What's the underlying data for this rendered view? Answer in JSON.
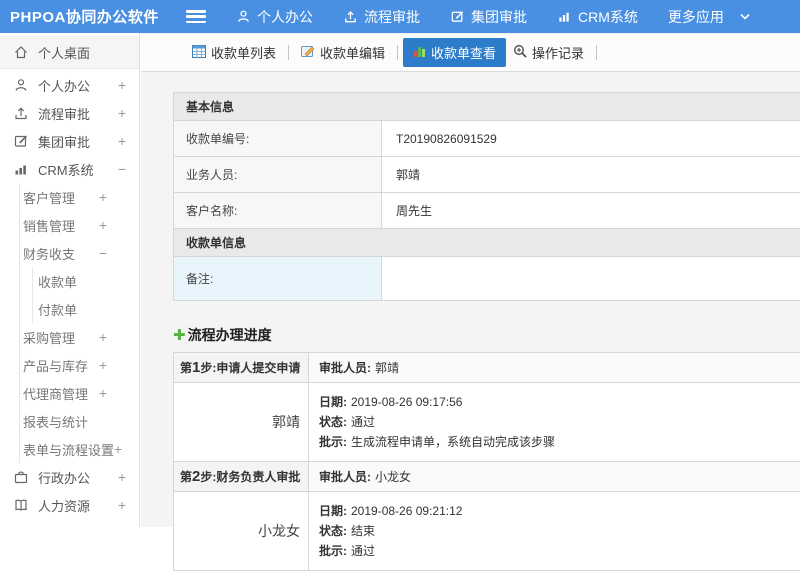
{
  "colors": {
    "topbar_blue": "#4a90e2",
    "active_tab_blue": "#2d7cc9",
    "plus_green": "#52b43a",
    "remark_label_bg": "#e8f5fc"
  },
  "icons": {
    "process_plus_glyph": "✚"
  },
  "header": {
    "app_title": "PHPOA协同办公软件",
    "nav": [
      {
        "label": "个人办公"
      },
      {
        "label": "流程审批"
      },
      {
        "label": "集团审批"
      },
      {
        "label": "CRM系统"
      },
      {
        "label": "更多应用"
      }
    ]
  },
  "sidebar": {
    "items": [
      {
        "label": "个人桌面",
        "exp": ""
      },
      {
        "label": "个人办公",
        "exp": "+"
      },
      {
        "label": "流程审批",
        "exp": "+"
      },
      {
        "label": "集团审批",
        "exp": "+"
      },
      {
        "label": "CRM系统",
        "exp": "−"
      },
      {
        "label": "客户管理",
        "exp": "+"
      },
      {
        "label": "销售管理",
        "exp": "+"
      },
      {
        "label": "财务收支",
        "exp": "−"
      },
      {
        "label": "收款单",
        "exp": ""
      },
      {
        "label": "付款单",
        "exp": ""
      },
      {
        "label": "采购管理",
        "exp": "+"
      },
      {
        "label": "产品与库存",
        "exp": "+"
      },
      {
        "label": "代理商管理",
        "exp": "+"
      },
      {
        "label": "报表与统计",
        "exp": ""
      },
      {
        "label": "表单与流程设置",
        "exp": "+"
      },
      {
        "label": "行政办公",
        "exp": "+"
      },
      {
        "label": "人力资源",
        "exp": "+"
      }
    ]
  },
  "tabs": [
    {
      "label": "收款单列表"
    },
    {
      "label": "收款单编辑"
    },
    {
      "label": "收款单查看"
    },
    {
      "label": "操作记录"
    }
  ],
  "basic_info": {
    "section1_title": "基本信息",
    "rows": [
      {
        "label": "收款单编号:",
        "value": "T20190826091529"
      },
      {
        "label": "业务人员:",
        "value": "郭靖"
      },
      {
        "label": "客户名称:",
        "value": "周先生"
      }
    ],
    "section2_title": "收款单信息",
    "remark_label": "备注:",
    "remark_value": ""
  },
  "process": {
    "title": "流程办理进度",
    "labels": {
      "approver": "审批人员:",
      "date": "日期:",
      "status": "状态:",
      "comment": "批示:"
    },
    "steps": [
      {
        "step_prefix": "第",
        "step_no": "1",
        "step_suffix": "步:申请人提交申请",
        "approver": "郭靖",
        "name": "郭靖",
        "date": "2019-08-26 09:17:56",
        "status": "通过",
        "comment": "生成流程申请单，系统自动完成该步骤"
      },
      {
        "step_prefix": "第",
        "step_no": "2",
        "step_suffix": "步:财务负责人审批",
        "approver": "小龙女",
        "name": "小龙女",
        "date": "2019-08-26 09:21:12",
        "status": "结束",
        "comment": "通过"
      }
    ]
  }
}
